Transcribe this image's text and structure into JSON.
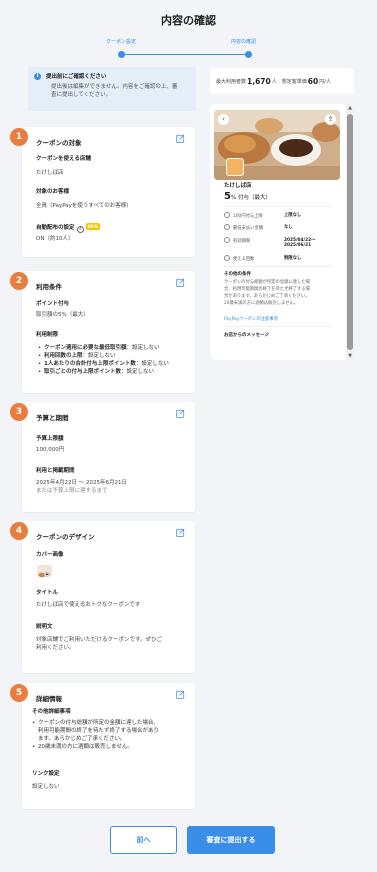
{
  "page": {
    "title": "内容の確認"
  },
  "stepper": {
    "steps": [
      {
        "label": "クーポン設定"
      },
      {
        "label": "内容の確認"
      }
    ],
    "current": 2
  },
  "notice": {
    "title": "提出前にご確認ください",
    "body_1": "提出後は編集ができません。内容をご確認の上、審",
    "body_2": "査に提出してください。"
  },
  "stats": {
    "users_label": "最大利用者数",
    "users_value": "1,670",
    "users_unit": "人",
    "price_label": "想定客単価",
    "price_value": "60",
    "price_unit": "円/人"
  },
  "sections": [
    {
      "number": "1",
      "title": "クーポンの対象",
      "fields": [
        {
          "label": "クーポンを使える店舗",
          "value": "たけしば店"
        },
        {
          "label": "対象のお客様",
          "value": "全員（PayPayを使うすべてのお客様）"
        },
        {
          "label": "自動配布の設定",
          "badge": "NEW",
          "value": "ON（約10人）"
        }
      ]
    },
    {
      "number": "2",
      "title": "利用条件",
      "fields": [
        {
          "label": "ポイント付与",
          "value": "取引額の5%（最大）"
        },
        {
          "label": "利用制限"
        }
      ],
      "limits": [
        {
          "label": "クーポン適用に必要な最低取引額",
          "value": "設定しない"
        },
        {
          "label": "利用回数の上限",
          "value": "設定しない"
        },
        {
          "label": "1人あたりの合計付与上限ポイント数",
          "value": "設定しない"
        },
        {
          "label": "取引ごとの付与上限ポイント数",
          "value": "設定しない"
        }
      ]
    },
    {
      "number": "3",
      "title": "予算と期間",
      "fields": [
        {
          "label": "予算上限額",
          "value": "100,000円"
        },
        {
          "label": "利用と掲載期間",
          "value": "2025年4月22日 ～ 2025年6月21日",
          "note": "または予算上限に達するまで"
        }
      ]
    },
    {
      "number": "4",
      "title": "クーポンのデザイン",
      "fields": [
        {
          "label": "カバー画像"
        },
        {
          "label": "タイトル",
          "value": "たけしば店で使えるおトクなクーポンです"
        },
        {
          "label": "説明文",
          "value_1": "対象店舗でご利用いただけるクーポンです。ぜひご",
          "value_2": "利用ください。"
        }
      ]
    },
    {
      "number": "5",
      "title": "詳細情報",
      "fields": [
        {
          "label": "その他詳細事項"
        },
        {
          "label": "リンク設定",
          "value": "設定しない"
        }
      ],
      "details": [
        {
          "line_1": "クーポンの付与総額が所定の金額に達した場合、",
          "line_2": "利用可能期間の終了を待たず終了する場合があり",
          "line_3": "ます。あらかじめご了承ください。"
        },
        {
          "line_1": "20歳未満の方に酒類は販売しません。"
        }
      ]
    }
  ],
  "preview": {
    "store_name": "たけしば店",
    "rate_value": "5",
    "rate_suffix": "% 付与（最大）",
    "rows": [
      {
        "label": "100円付与上限",
        "value": "上限なし"
      },
      {
        "label": "最低支払い金額",
        "value": "なし"
      },
      {
        "label": "有効期限",
        "value": "2025/04/22～",
        "value_2": "2025/06/21"
      },
      {
        "label": "使える回数",
        "value": "制限なし"
      }
    ],
    "conditions_title": "その他の条件",
    "conditions_1": "クーポンの付与総額が所定の金額に達した場",
    "conditions_2": "合、利用可能期間の終了を待たず終了する場",
    "conditions_3": "合があります。あらかじめご了承ください。",
    "conditions_4": "20歳未満の方に酒類は販売しません。",
    "link": "PayPayクーポンの注意事項",
    "message_title": "お店からのメッセージ"
  },
  "buttons": {
    "back": "前へ",
    "submit": "審査に提出する"
  },
  "colors": {
    "accent": "#3a8ee8",
    "badge": "#e87d3e",
    "new_badge": "#f7c300"
  }
}
